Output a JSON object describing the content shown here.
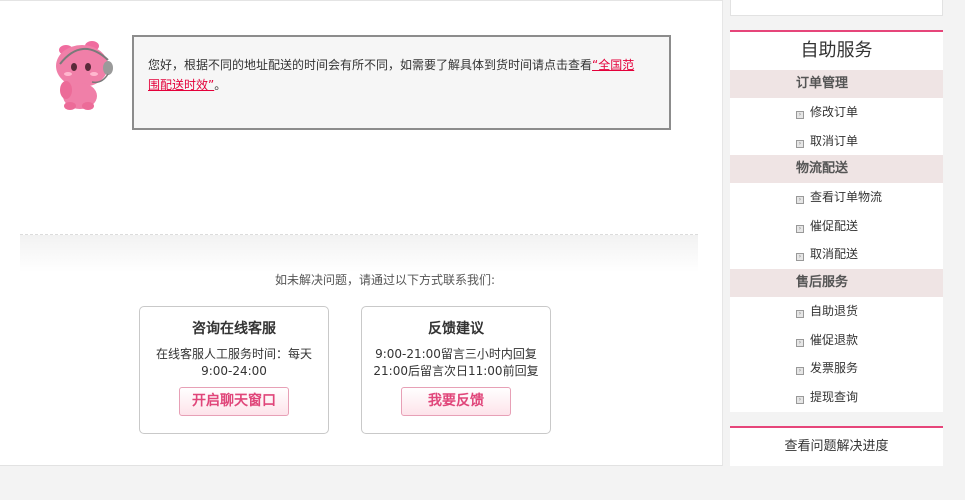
{
  "notice": {
    "text": "您好，根据不同的地址配送的时间会有所不同，如需要了解具体到货时间请点击查看",
    "link_text": "“全国范围配送时效”",
    "suffix": "。"
  },
  "contact": {
    "hint": "如未解决问题，请通过以下方式联系我们:",
    "cards": [
      {
        "title": "咨询在线客服",
        "desc_line1": "在线客服人工服务时间：每天",
        "desc_line2": "9:00-24:00",
        "button": "开启聊天窗口"
      },
      {
        "title": "反馈建议",
        "desc_line1": "9:00-21:00留言三小时内回复",
        "desc_line2": "21:00后留言次日11:00前回复",
        "button": "我要反馈"
      }
    ]
  },
  "sidebar": {
    "title": "自助服务",
    "groups": [
      {
        "label": "订单管理",
        "items": [
          "修改订单",
          "取消订单"
        ]
      },
      {
        "label": "物流配送",
        "items": [
          "查看订单物流",
          "催促配送",
          "取消配送"
        ]
      },
      {
        "label": "售后服务",
        "items": [
          "自助退货",
          "催促退款",
          "发票服务",
          "提现查询"
        ]
      }
    ],
    "progress_link": "查看问题解决进度"
  },
  "colors": {
    "accent": "#e6457a",
    "link": "#e4003a",
    "group_bg": "#efe4e4"
  }
}
